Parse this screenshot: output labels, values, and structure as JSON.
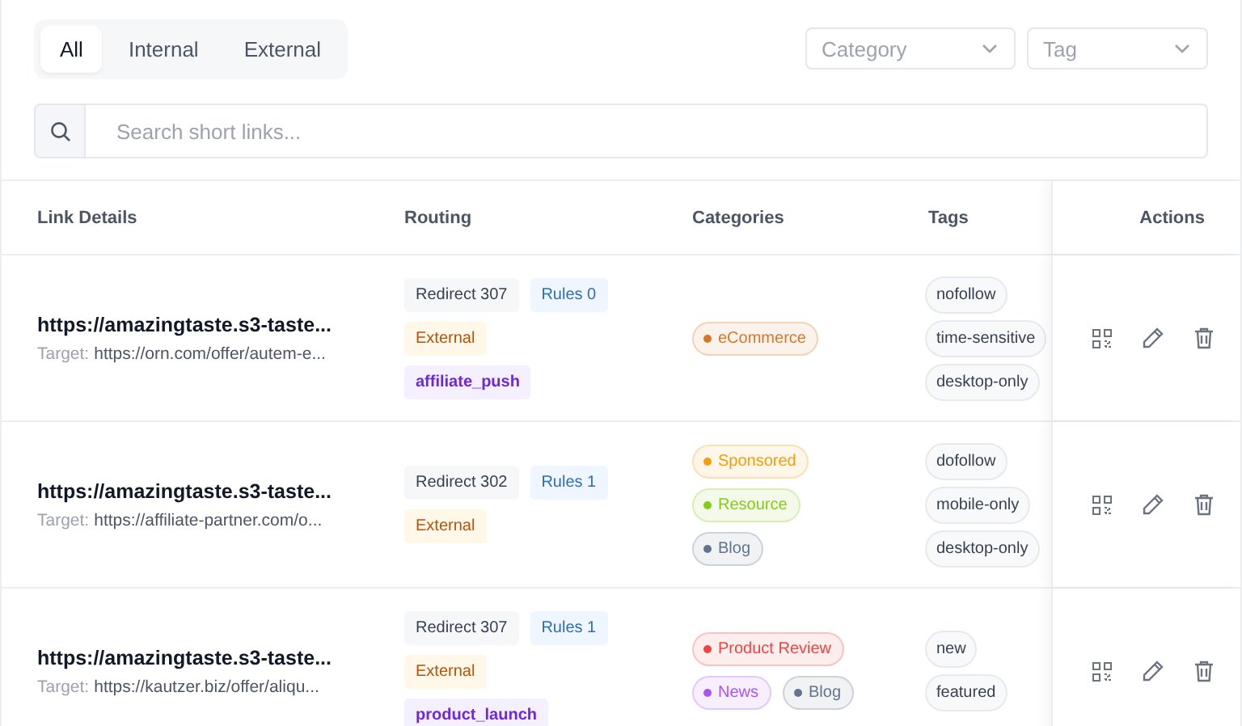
{
  "tabs": [
    {
      "label": "All",
      "selected": true
    },
    {
      "label": "Internal",
      "selected": false
    },
    {
      "label": "External",
      "selected": false
    }
  ],
  "filters": [
    {
      "placeholder": "Category"
    },
    {
      "placeholder": "Tag"
    }
  ],
  "search": {
    "placeholder": "Search short links..."
  },
  "table": {
    "columns": [
      "Link Details",
      "Routing",
      "Categories",
      "Tags",
      "Actions"
    ],
    "rows": [
      {
        "short_url": "https://amazingtaste.s3-taste...",
        "target_label": "Target:",
        "target": "https://orn.com/offer/autem-e...",
        "routing": [
          {
            "kind": "redirect",
            "text": "Redirect 307"
          },
          {
            "kind": "rules",
            "text": "Rules 0"
          },
          {
            "kind": "scope",
            "text": "External"
          },
          {
            "kind": "campaign",
            "text": "affiliate_push"
          }
        ],
        "categories": [
          {
            "name": "eCommerce",
            "color": "#d97726"
          }
        ],
        "tags": [
          "nofollow",
          "time-sensitive",
          "desktop-only"
        ]
      },
      {
        "short_url": "https://amazingtaste.s3-taste...",
        "target_label": "Target:",
        "target": "https://affiliate-partner.com/o...",
        "routing": [
          {
            "kind": "redirect",
            "text": "Redirect 302"
          },
          {
            "kind": "rules",
            "text": "Rules 1"
          },
          {
            "kind": "scope",
            "text": "External"
          }
        ],
        "categories": [
          {
            "name": "Sponsored",
            "color": "#f59e0b"
          },
          {
            "name": "Resource",
            "color": "#84cc16"
          },
          {
            "name": "Blog",
            "color": "#64748b"
          }
        ],
        "tags": [
          "dofollow",
          "mobile-only",
          "desktop-only"
        ]
      },
      {
        "short_url": "https://amazingtaste.s3-taste...",
        "target_label": "Target:",
        "target": "https://kautzer.biz/offer/aliqu...",
        "routing": [
          {
            "kind": "redirect",
            "text": "Redirect 307"
          },
          {
            "kind": "rules",
            "text": "Rules 1"
          },
          {
            "kind": "scope",
            "text": "External"
          },
          {
            "kind": "campaign",
            "text": "product_launch"
          }
        ],
        "categories": [
          {
            "name": "Product Review",
            "color": "#ef4444"
          },
          {
            "name": "News",
            "color": "#a855f7"
          },
          {
            "name": "Blog",
            "color": "#64748b"
          }
        ],
        "tags": [
          "new",
          "featured"
        ]
      }
    ]
  }
}
